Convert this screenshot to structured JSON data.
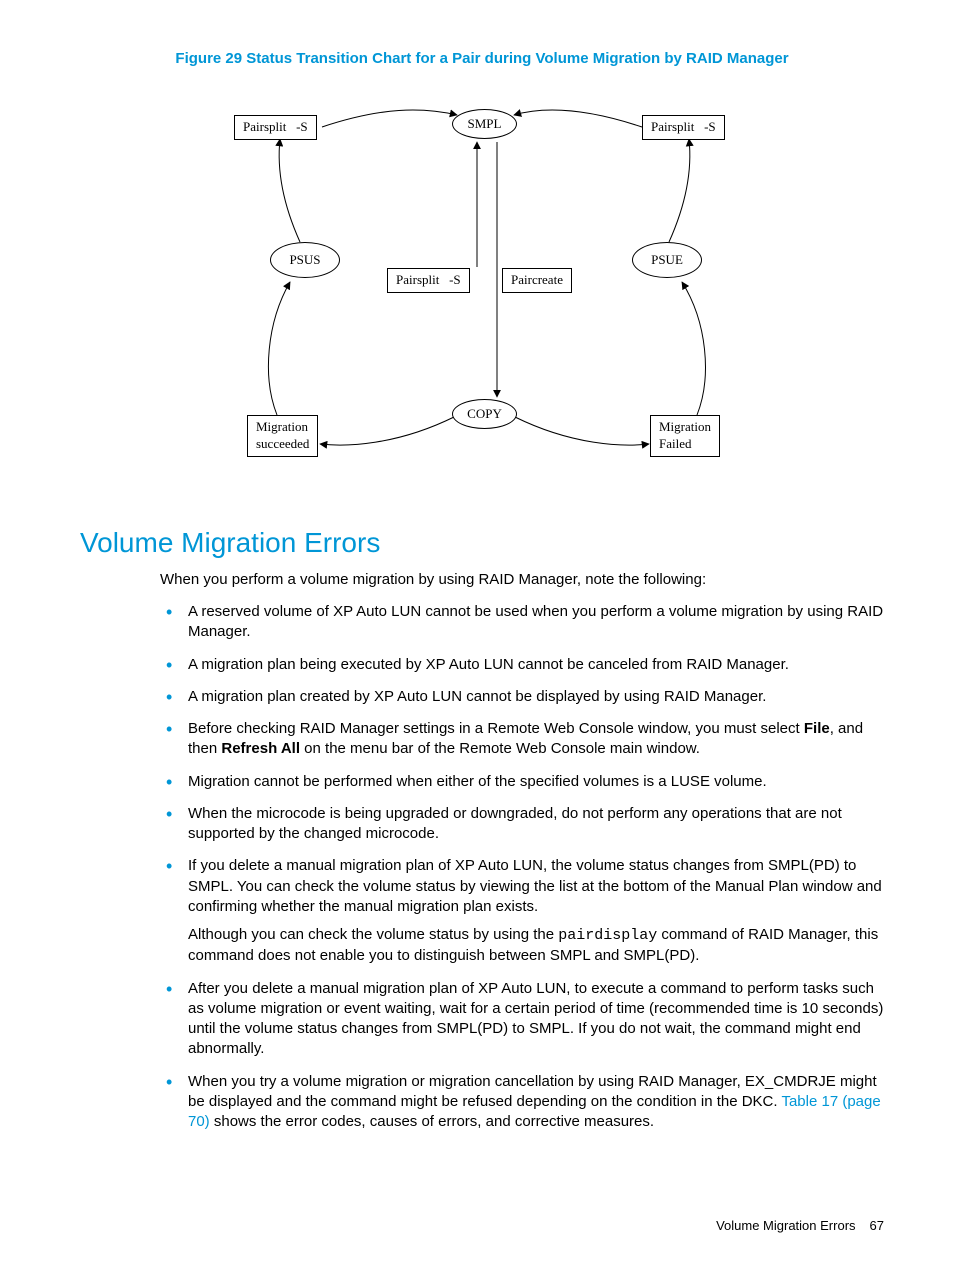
{
  "figure": {
    "caption": "Figure 29 Status Transition Chart for a Pair during Volume Migration by RAID Manager",
    "nodes": {
      "smpl": "SMPL",
      "copy": "COPY",
      "psus": "PSUS",
      "psue": "PSUE",
      "pairsplit_left": "Pairsplit   -S",
      "pairsplit_right": "Pairsplit   -S",
      "pairsplit_mid": "Pairsplit   -S",
      "paircreate": "Paircreate",
      "migration_succeeded": "Migration\nsucceeded",
      "migration_failed": "Migration\nFailed"
    }
  },
  "section": {
    "heading": "Volume Migration Errors",
    "intro": "When you perform a volume migration by using RAID Manager, note the following:",
    "items": [
      {
        "parts": [
          {
            "t": "A reserved volume of XP Auto LUN cannot be used when you perform a volume migration by using RAID Manager."
          }
        ]
      },
      {
        "parts": [
          {
            "t": "A migration plan being executed by XP Auto LUN cannot be canceled from RAID Manager."
          }
        ]
      },
      {
        "parts": [
          {
            "t": "A migration plan created by XP Auto LUN cannot be displayed by using RAID Manager."
          }
        ]
      },
      {
        "parts": [
          {
            "t": "Before checking RAID Manager settings in a Remote Web Console window, you must select "
          },
          {
            "t": "File",
            "cls": "bold"
          },
          {
            "t": ", and then "
          },
          {
            "t": "Refresh All",
            "cls": "bold"
          },
          {
            "t": " on the menu bar of the Remote Web Console main window."
          }
        ]
      },
      {
        "parts": [
          {
            "t": "Migration cannot be performed when either of the specified volumes is a LUSE volume."
          }
        ]
      },
      {
        "parts": [
          {
            "t": "When the microcode is being upgraded or downgraded, do not perform any operations that are not supported by the changed microcode."
          }
        ]
      },
      {
        "parts": [
          {
            "t": "If you delete a manual migration plan of XP Auto LUN, the volume status changes from SMPL(PD) to SMPL. You can check the volume status by viewing the list at the bottom of the Manual Plan window and confirming whether the manual migration plan exists."
          }
        ],
        "extra_parts": [
          {
            "t": "Although you can check the volume status by using the "
          },
          {
            "t": "pairdisplay",
            "cls": "mono"
          },
          {
            "t": " command of RAID Manager, this command does not enable you to distinguish between SMPL and SMPL(PD)."
          }
        ]
      },
      {
        "parts": [
          {
            "t": "After you delete a manual migration plan of XP Auto LUN, to execute a command to perform tasks such as volume migration or event waiting, wait for a certain period of time (recommended time is 10 seconds) until the volume status changes from SMPL(PD) to SMPL. If you do not wait, the command might end abnormally."
          }
        ]
      },
      {
        "parts": [
          {
            "t": "When you try a volume migration or migration cancellation by using RAID Manager, EX_CMDRJE might be displayed and the command might be refused depending on the condition in the DKC. "
          },
          {
            "t": "Table 17 (page 70)",
            "cls": "link"
          },
          {
            "t": " shows the error codes, causes of errors, and corrective measures."
          }
        ]
      }
    ]
  },
  "footer": {
    "title": "Volume Migration Errors",
    "page": "67"
  }
}
